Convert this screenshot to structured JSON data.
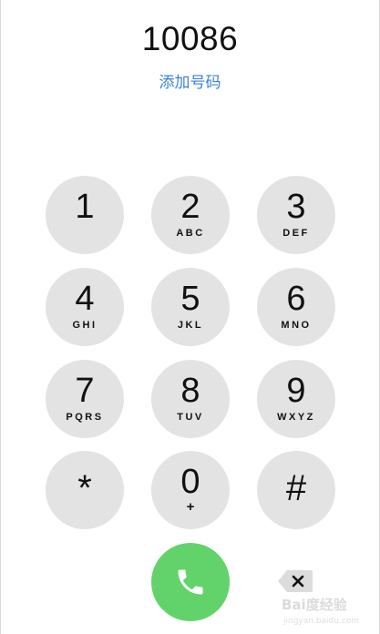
{
  "display": {
    "number": "10086",
    "add_number_label": "添加号码"
  },
  "keypad": {
    "keys": [
      {
        "digit": "1",
        "letters": ""
      },
      {
        "digit": "2",
        "letters": "ABC"
      },
      {
        "digit": "3",
        "letters": "DEF"
      },
      {
        "digit": "4",
        "letters": "GHI"
      },
      {
        "digit": "5",
        "letters": "JKL"
      },
      {
        "digit": "6",
        "letters": "MNO"
      },
      {
        "digit": "7",
        "letters": "PQRS"
      },
      {
        "digit": "8",
        "letters": "TUV"
      },
      {
        "digit": "9",
        "letters": "WXYZ"
      },
      {
        "digit": "*",
        "letters": ""
      },
      {
        "digit": "0",
        "letters": "+"
      },
      {
        "digit": "#",
        "letters": ""
      }
    ]
  },
  "actions": {
    "call_icon": "phone-icon",
    "delete_icon": "backspace-icon"
  },
  "watermark": {
    "text": "Bai度经验",
    "sub": "jingyan.baidu.com"
  },
  "colors": {
    "accent_blue": "#3a82d8",
    "key_background": "#e3e3e3",
    "call_green": "#62d36a"
  }
}
